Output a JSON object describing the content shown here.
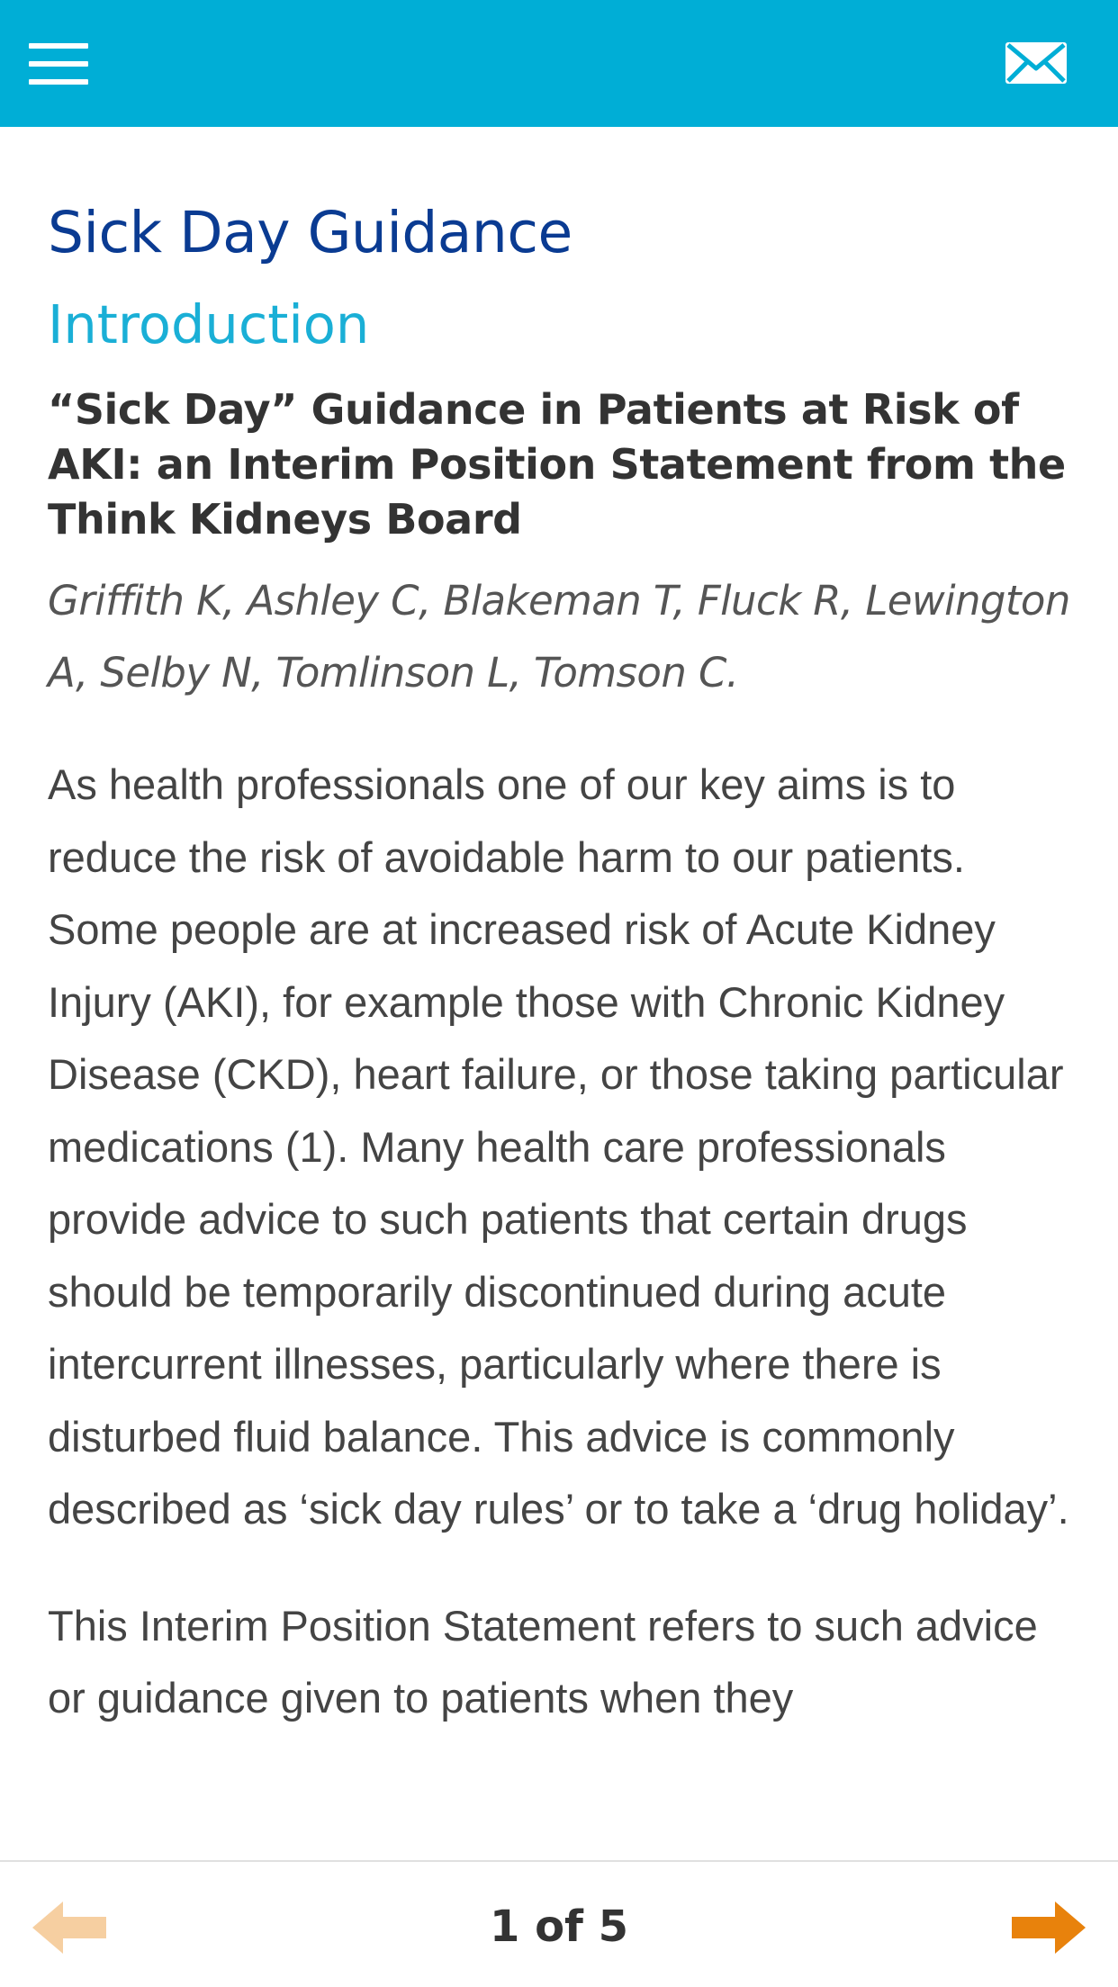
{
  "header": {
    "menu_icon": "hamburger-menu-icon",
    "mail_icon": "envelope-icon",
    "background_color": "#00aed6"
  },
  "main": {
    "page_title": "Sick Day Guidance",
    "section_title": "Introduction",
    "article_title": "“Sick Day” Guidance in Patients at Risk of AKI: an Interim Position Statement from the Think Kidneys Board",
    "authors": "Griffith K, Ashley C, Blakeman T, Fluck R, Lewington A, Selby N, Tomlinson L, Tomson C.",
    "paragraphs": [
      "As health professionals one of our key aims is to reduce the risk of avoidable harm to our patients. Some people are at increased risk of Acute Kidney Injury (AKI), for example those with Chronic Kidney Disease (CKD), heart failure, or those taking particular medications (1). Many health care professionals provide advice to such patients that certain drugs should be temporarily discontinued during acute intercurrent illnesses, particularly where there is disturbed fluid balance. This advice is commonly described as ‘sick day rules’ or to take a ‘drug holiday’.",
      "This Interim Position Statement refers to such advice or guidance given to patients when they"
    ]
  },
  "footer": {
    "page_indicator": "1 of 5",
    "prev_icon": "arrow-left-icon",
    "next_icon": "arrow-right-icon",
    "arrow_color": "#e8820c",
    "prev_enabled": false
  }
}
